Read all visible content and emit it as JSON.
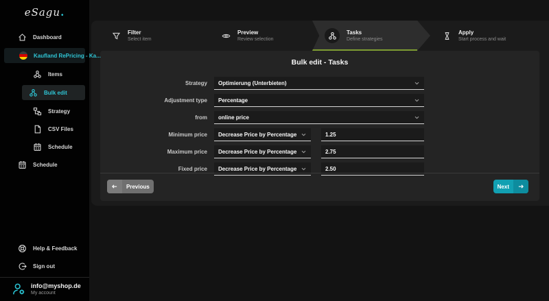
{
  "brand": {
    "name": "eSagu",
    "dot": "."
  },
  "colors": {
    "accent_cyan": "#2ac4d4",
    "button_teal": "#12a0b2",
    "step_green": "#7f9d32",
    "panel_bg": "#1b1b1b",
    "card_bg": "#242424",
    "sidebar_bg": "#020202"
  },
  "sidebar": {
    "items": [
      {
        "label": "Dashboard",
        "icon": "home-icon"
      },
      {
        "label": "Kaufland RePricing - Ka...",
        "icon": "german-flag-icon"
      },
      {
        "label": "Items",
        "icon": "items-icon"
      },
      {
        "label": "Bulk edit",
        "icon": "bulk-edit-icon"
      },
      {
        "label": "Strategy",
        "icon": "strategy-icon"
      },
      {
        "label": "CSV Files",
        "icon": "csv-file-icon"
      },
      {
        "label": "Schedule",
        "icon": "calendar-icon"
      },
      {
        "label": "Schedule",
        "icon": "calendar-icon"
      }
    ],
    "footer": [
      {
        "label": "Help & Feedback",
        "icon": "help-icon"
      },
      {
        "label": "Sign out",
        "icon": "sign-out-icon"
      }
    ],
    "account": {
      "email": "info@myshop.de",
      "label": "My account"
    }
  },
  "stepper": {
    "steps": [
      {
        "title": "Filter",
        "subtitle": "Select item",
        "icon": "funnel-icon",
        "active": false
      },
      {
        "title": "Preview",
        "subtitle": "Review selection",
        "icon": "eye-icon",
        "active": false
      },
      {
        "title": "Tasks",
        "subtitle": "Define strategies",
        "icon": "tasks-icon",
        "active": true
      },
      {
        "title": "Apply",
        "subtitle": "Start process and wait",
        "icon": "hourglass-icon",
        "active": false
      }
    ]
  },
  "form": {
    "title": "Bulk edit - Tasks",
    "rows": [
      {
        "label": "Strategy",
        "value": "Optimierung (Unterbieten)"
      },
      {
        "label": "Adjustment type",
        "value": "Percentage"
      },
      {
        "label": "from",
        "value": "online price"
      },
      {
        "label": "Minimum price",
        "value": "Decrease Price by Percentage",
        "amount": "1.25"
      },
      {
        "label": "Maximum price",
        "value": "Decrease Price by Percentage",
        "amount": "2.75"
      },
      {
        "label": "Fixed price",
        "value": "Decrease Price by Percentage",
        "amount": "2.50"
      }
    ],
    "buttons": {
      "previous": "Previous",
      "next": "Next"
    }
  }
}
